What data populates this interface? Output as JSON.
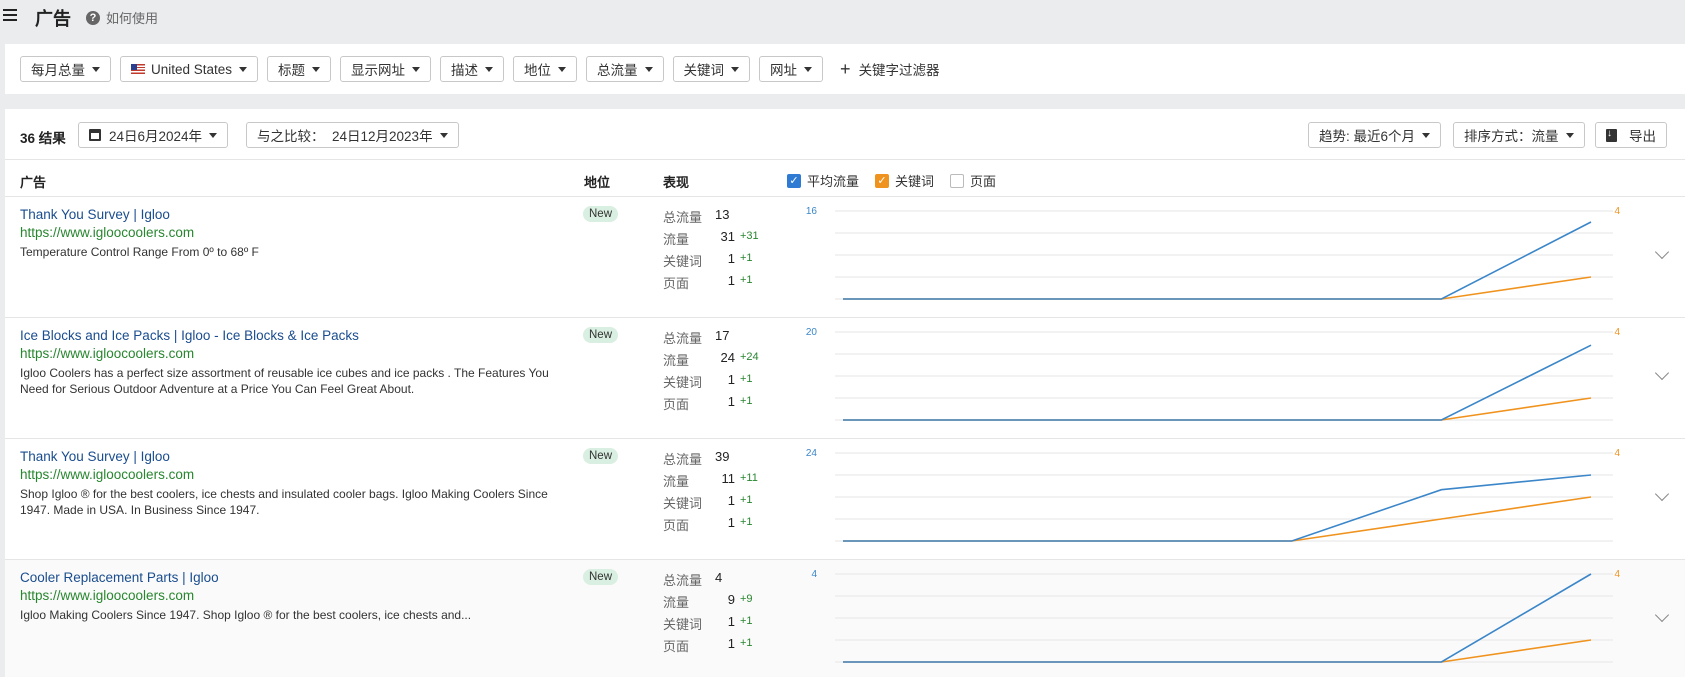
{
  "header": {
    "title": "广告",
    "help_label": "如何使用"
  },
  "filters": {
    "buttons": [
      "每月总量",
      "United States",
      "标题",
      "显示网址",
      "描述",
      "地位",
      "总流量",
      "关键词",
      "网址"
    ],
    "keyword_filter_label": "关键字过滤器"
  },
  "results": {
    "count_label": "36 结果",
    "date_label": "24日6月2024年",
    "compare_label": "与之比较：  24日12月2023年",
    "trend_label": "趋势: 最近6个月",
    "sort_label": "排序方式：流量",
    "export_label": "导出"
  },
  "columns": {
    "ad": "广告",
    "position": "地位",
    "performance": "表现",
    "legend": {
      "avg_traffic": "平均流量",
      "keywords": "关键词",
      "pages": "页面"
    }
  },
  "colors": {
    "traffic": "#3b86c9",
    "keywords": "#f0931e",
    "new_badge": "#d9efe1"
  },
  "perf_labels": {
    "total": "总流量",
    "traffic": "流量",
    "keywords": "关键词",
    "pages": "页面"
  },
  "ads": [
    {
      "title": "Thank You Survey | Igloo",
      "url": "https://www.igloocoolers.com",
      "desc": "Temperature Control Range From 0º to 68º F",
      "badge": "New",
      "total": "13",
      "traffic": "31",
      "traffic_delta": "+31",
      "keywords": "1",
      "keywords_delta": "+1",
      "pages": "1",
      "pages_delta": "+1",
      "chart": {
        "left_max": "16",
        "right_max": "4"
      }
    },
    {
      "title": "Ice Blocks and Ice Packs | Igloo - Ice Blocks & Ice Packs",
      "url": "https://www.igloocoolers.com",
      "desc": "Igloo Coolers has a perfect size assortment of reusable ice cubes and ice packs . The Features You Need for Serious Outdoor Adventure at a Price You Can Feel Great About.",
      "badge": "New",
      "total": "17",
      "traffic": "24",
      "traffic_delta": "+24",
      "keywords": "1",
      "keywords_delta": "+1",
      "pages": "1",
      "pages_delta": "+1",
      "chart": {
        "left_max": "20",
        "right_max": "4"
      }
    },
    {
      "title": "Thank You Survey | Igloo",
      "url": "https://www.igloocoolers.com",
      "desc": "Shop Igloo ® for the best coolers, ice chests and insulated cooler bags. Igloo Making Coolers Since 1947. Made in USA. In Business Since 1947.",
      "badge": "New",
      "total": "39",
      "traffic": "11",
      "traffic_delta": "+11",
      "keywords": "1",
      "keywords_delta": "+1",
      "pages": "1",
      "pages_delta": "+1",
      "chart": {
        "left_max": "24",
        "right_max": "4"
      }
    },
    {
      "title": "Cooler Replacement Parts | Igloo",
      "url": "https://www.igloocoolers.com",
      "desc": "Igloo Making Coolers Since 1947. Shop Igloo ® for the best coolers, ice chests and...",
      "badge": "New",
      "total": "4",
      "traffic": "9",
      "traffic_delta": "+9",
      "keywords": "1",
      "keywords_delta": "+1",
      "pages": "1",
      "pages_delta": "+1",
      "chart": {
        "left_max": "4",
        "right_max": "4"
      }
    }
  ],
  "chart_data": [
    {
      "type": "line",
      "ylim_left": [
        0,
        16
      ],
      "ylim_right": [
        0,
        4
      ],
      "series": [
        {
          "values": [
            0,
            0,
            0,
            0,
            0,
            14
          ]
        },
        {
          "values": [
            0,
            0,
            0,
            0,
            0,
            1
          ]
        }
      ]
    },
    {
      "type": "line",
      "ylim_left": [
        0,
        20
      ],
      "ylim_right": [
        0,
        4
      ],
      "series": [
        {
          "values": [
            0,
            0,
            0,
            0,
            0,
            17
          ]
        },
        {
          "values": [
            0,
            0,
            0,
            0,
            0,
            1
          ]
        }
      ]
    },
    {
      "type": "line",
      "ylim_left": [
        0,
        24
      ],
      "ylim_right": [
        0,
        4
      ],
      "series": [
        {
          "values": [
            0,
            0,
            0,
            0,
            14,
            18
          ]
        },
        {
          "values": [
            0,
            0,
            0,
            0,
            1,
            2
          ]
        }
      ]
    },
    {
      "type": "line",
      "ylim_left": [
        0,
        4
      ],
      "ylim_right": [
        0,
        4
      ],
      "series": [
        {
          "values": [
            0,
            0,
            0,
            0,
            0,
            4
          ]
        },
        {
          "values": [
            0,
            0,
            0,
            0,
            0,
            1
          ]
        }
      ]
    }
  ]
}
